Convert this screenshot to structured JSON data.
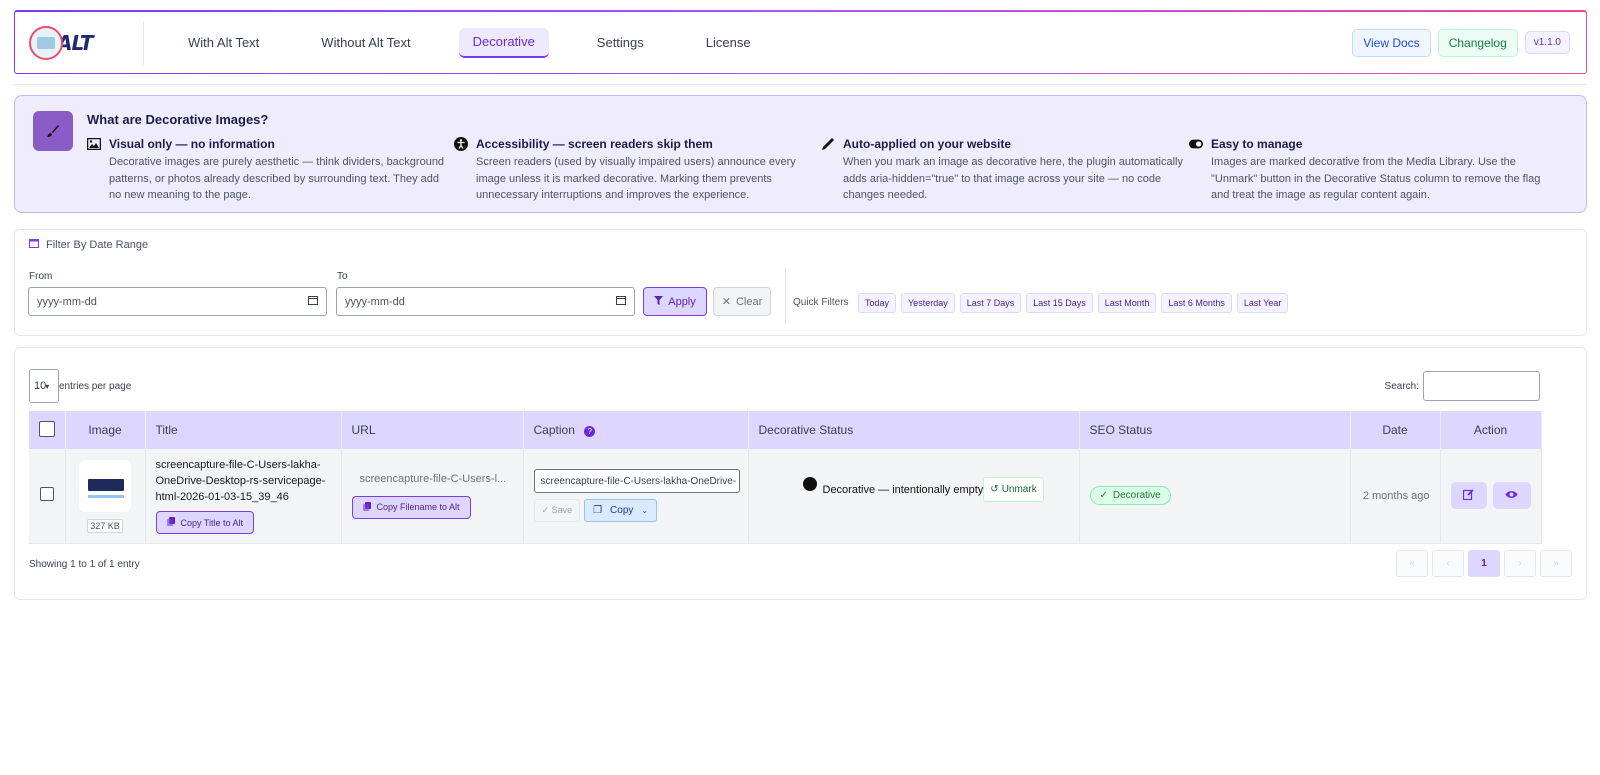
{
  "header": {
    "logo_text": "ALT",
    "tabs": [
      {
        "label": "With Alt Text"
      },
      {
        "label": "Without Alt Text"
      },
      {
        "label": "Decorative"
      },
      {
        "label": "Settings"
      },
      {
        "label": "License"
      }
    ],
    "active_tab": "Decorative",
    "view_docs": "View Docs",
    "changelog": "Changelog",
    "version": "v1.1.0"
  },
  "info": {
    "title": "What are Decorative Images?",
    "columns": [
      {
        "icon": "image-icon",
        "heading": "Visual only — no information",
        "body": "Decorative images are purely aesthetic — think dividers, background patterns, or photos already described by surrounding text. They add no new meaning to the page."
      },
      {
        "icon": "accessibility-icon",
        "heading": "Accessibility — screen readers skip them",
        "body": "Screen readers (used by visually impaired users) announce every image unless it is marked decorative. Marking them prevents unnecessary interruptions and improves the experience."
      },
      {
        "icon": "pencil-icon",
        "heading": "Auto-applied on your website",
        "body": "When you mark an image as decorative here, the plugin automatically adds aria-hidden=\"true\" to that image across your site — no code changes needed."
      },
      {
        "icon": "toggle-icon",
        "heading": "Easy to manage",
        "body": "Images are marked decorative from the Media Library. Use the \"Unmark\" button in the Decorative Status column to remove the flag and treat the image as regular content again."
      }
    ]
  },
  "filter": {
    "title": "Filter By Date Range",
    "from_label": "From",
    "to_label": "To",
    "from_placeholder": "yyyy-mm-dd",
    "to_placeholder": "yyyy-mm-dd",
    "apply": "Apply",
    "clear": "Clear",
    "quick_label": "Quick Filters",
    "quick": [
      "Today",
      "Yesterday",
      "Last 7 Days",
      "Last 15 Days",
      "Last Month",
      "Last 6 Months",
      "Last Year"
    ]
  },
  "table": {
    "entries_value": "10",
    "entries_label": "entries per page",
    "search_label": "Search:",
    "columns": [
      "Image",
      "Title",
      "URL",
      "Caption",
      "Decorative Status",
      "SEO Status",
      "Date",
      "Action"
    ],
    "rows": [
      {
        "size": "327 KB",
        "title": "screencapture-file-C-Users-lakha-OneDrive-Desktop-rs-servicepage-html-2026-01-03-15_39_46",
        "copy_title": "Copy Title to Alt",
        "url": "screencapture-file-C-Users-l...",
        "copy_filename": "Copy Filename to Alt",
        "caption": "screencapture-file-C-Users-lakha-OneDrive-",
        "save": "Save",
        "copy": "Copy",
        "decorative_status": "Decorative — intentionally empty",
        "unmark": "Unmark",
        "seo_status": "Decorative",
        "date": "2 months ago"
      }
    ],
    "showing": "Showing 1 to 1 of 1 entry",
    "pager": [
      "«",
      "‹",
      "1",
      "›",
      "»"
    ],
    "current_page": "1"
  },
  "colors": {
    "accent": "#7c3aed",
    "accent_light": "#ddd6fe",
    "success": "#15803d"
  }
}
